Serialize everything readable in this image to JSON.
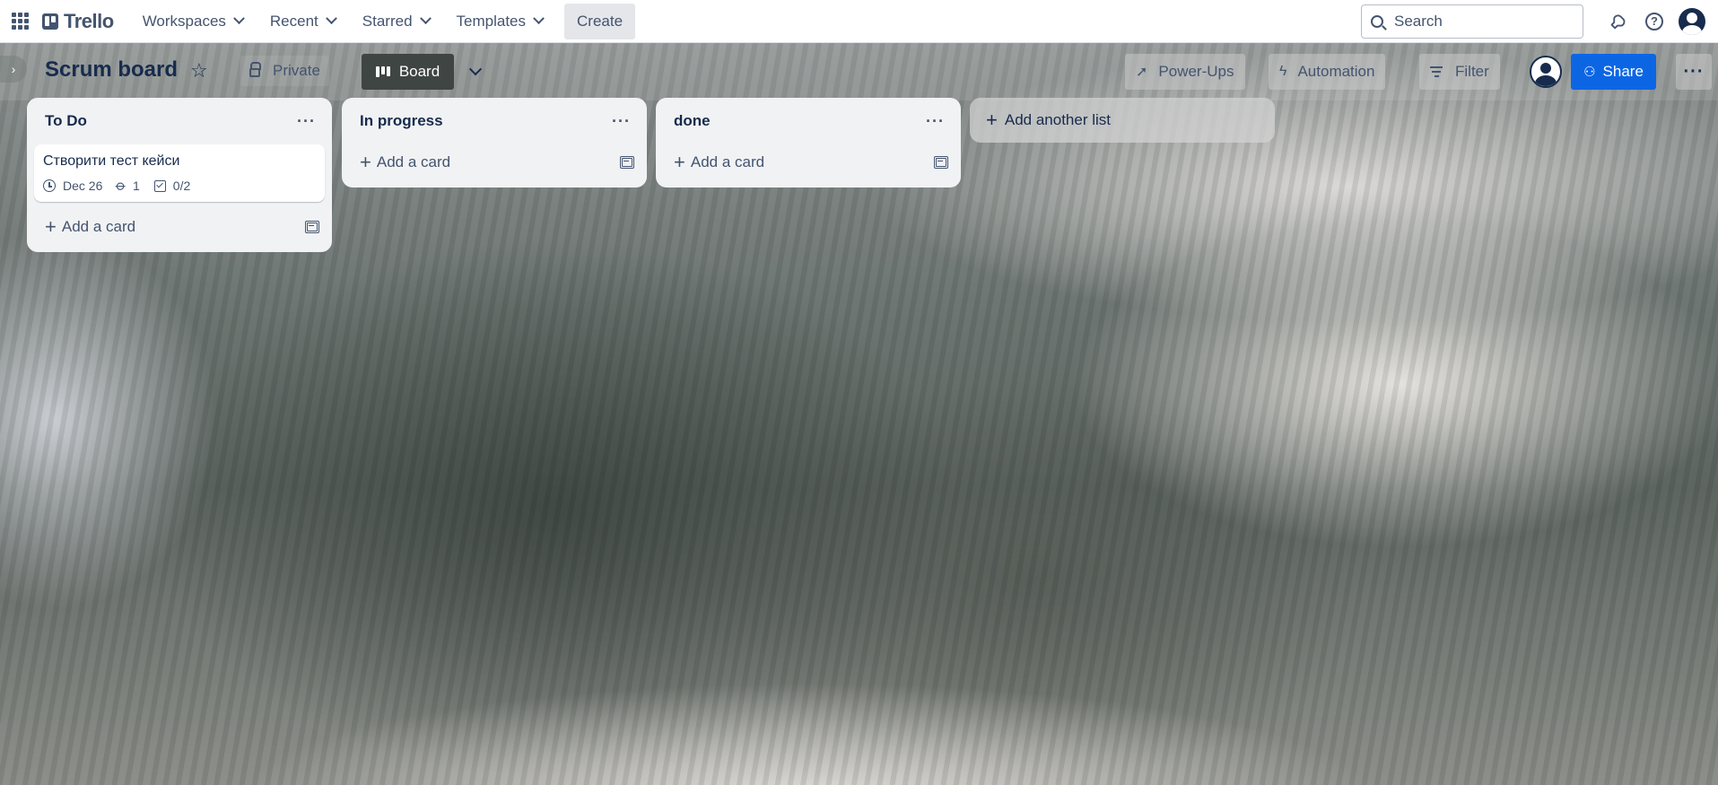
{
  "topbar": {
    "logo": "Trello",
    "nav": [
      "Workspaces",
      "Recent",
      "Starred",
      "Templates"
    ],
    "create_label": "Create",
    "search_placeholder": "Search"
  },
  "board": {
    "title": "Scrum board",
    "visibility": "Private",
    "view_label": "Board",
    "powerups_label": "Power-Ups",
    "automation_label": "Automation",
    "filter_label": "Filter",
    "share_label": "Share",
    "more_label": "···"
  },
  "lists": [
    {
      "title": "To Do",
      "cards": [
        {
          "title": "Створити тест кейси",
          "due": "Dec 26",
          "attachments": "1",
          "checklist": "0/2"
        }
      ],
      "add_card_label": "Add a card"
    },
    {
      "title": "In progress",
      "cards": [],
      "add_card_label": "Add a card"
    },
    {
      "title": "done",
      "cards": [],
      "add_card_label": "Add a card"
    }
  ],
  "add_list_label": "Add another list",
  "list_menu_label": "···",
  "colors": {
    "brand": "#44546f",
    "share": "#0c66e4",
    "list_bg": "#f1f2f4"
  }
}
